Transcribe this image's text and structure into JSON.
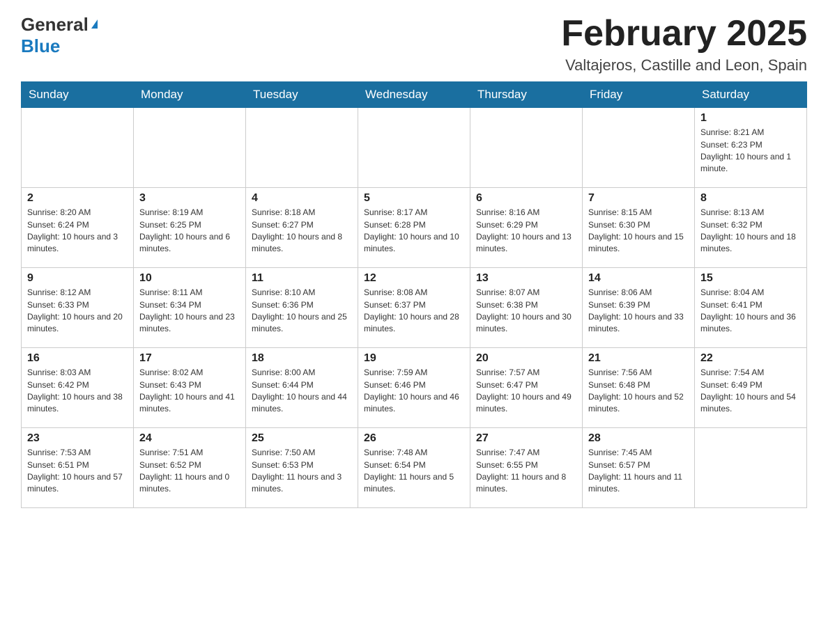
{
  "header": {
    "logo_general": "General",
    "logo_blue": "Blue",
    "title": "February 2025",
    "location": "Valtajeros, Castille and Leon, Spain"
  },
  "days_of_week": [
    "Sunday",
    "Monday",
    "Tuesday",
    "Wednesday",
    "Thursday",
    "Friday",
    "Saturday"
  ],
  "weeks": [
    {
      "days": [
        {
          "number": "",
          "info": ""
        },
        {
          "number": "",
          "info": ""
        },
        {
          "number": "",
          "info": ""
        },
        {
          "number": "",
          "info": ""
        },
        {
          "number": "",
          "info": ""
        },
        {
          "number": "",
          "info": ""
        },
        {
          "number": "1",
          "info": "Sunrise: 8:21 AM\nSunset: 6:23 PM\nDaylight: 10 hours and 1 minute."
        }
      ]
    },
    {
      "days": [
        {
          "number": "2",
          "info": "Sunrise: 8:20 AM\nSunset: 6:24 PM\nDaylight: 10 hours and 3 minutes."
        },
        {
          "number": "3",
          "info": "Sunrise: 8:19 AM\nSunset: 6:25 PM\nDaylight: 10 hours and 6 minutes."
        },
        {
          "number": "4",
          "info": "Sunrise: 8:18 AM\nSunset: 6:27 PM\nDaylight: 10 hours and 8 minutes."
        },
        {
          "number": "5",
          "info": "Sunrise: 8:17 AM\nSunset: 6:28 PM\nDaylight: 10 hours and 10 minutes."
        },
        {
          "number": "6",
          "info": "Sunrise: 8:16 AM\nSunset: 6:29 PM\nDaylight: 10 hours and 13 minutes."
        },
        {
          "number": "7",
          "info": "Sunrise: 8:15 AM\nSunset: 6:30 PM\nDaylight: 10 hours and 15 minutes."
        },
        {
          "number": "8",
          "info": "Sunrise: 8:13 AM\nSunset: 6:32 PM\nDaylight: 10 hours and 18 minutes."
        }
      ]
    },
    {
      "days": [
        {
          "number": "9",
          "info": "Sunrise: 8:12 AM\nSunset: 6:33 PM\nDaylight: 10 hours and 20 minutes."
        },
        {
          "number": "10",
          "info": "Sunrise: 8:11 AM\nSunset: 6:34 PM\nDaylight: 10 hours and 23 minutes."
        },
        {
          "number": "11",
          "info": "Sunrise: 8:10 AM\nSunset: 6:36 PM\nDaylight: 10 hours and 25 minutes."
        },
        {
          "number": "12",
          "info": "Sunrise: 8:08 AM\nSunset: 6:37 PM\nDaylight: 10 hours and 28 minutes."
        },
        {
          "number": "13",
          "info": "Sunrise: 8:07 AM\nSunset: 6:38 PM\nDaylight: 10 hours and 30 minutes."
        },
        {
          "number": "14",
          "info": "Sunrise: 8:06 AM\nSunset: 6:39 PM\nDaylight: 10 hours and 33 minutes."
        },
        {
          "number": "15",
          "info": "Sunrise: 8:04 AM\nSunset: 6:41 PM\nDaylight: 10 hours and 36 minutes."
        }
      ]
    },
    {
      "days": [
        {
          "number": "16",
          "info": "Sunrise: 8:03 AM\nSunset: 6:42 PM\nDaylight: 10 hours and 38 minutes."
        },
        {
          "number": "17",
          "info": "Sunrise: 8:02 AM\nSunset: 6:43 PM\nDaylight: 10 hours and 41 minutes."
        },
        {
          "number": "18",
          "info": "Sunrise: 8:00 AM\nSunset: 6:44 PM\nDaylight: 10 hours and 44 minutes."
        },
        {
          "number": "19",
          "info": "Sunrise: 7:59 AM\nSunset: 6:46 PM\nDaylight: 10 hours and 46 minutes."
        },
        {
          "number": "20",
          "info": "Sunrise: 7:57 AM\nSunset: 6:47 PM\nDaylight: 10 hours and 49 minutes."
        },
        {
          "number": "21",
          "info": "Sunrise: 7:56 AM\nSunset: 6:48 PM\nDaylight: 10 hours and 52 minutes."
        },
        {
          "number": "22",
          "info": "Sunrise: 7:54 AM\nSunset: 6:49 PM\nDaylight: 10 hours and 54 minutes."
        }
      ]
    },
    {
      "days": [
        {
          "number": "23",
          "info": "Sunrise: 7:53 AM\nSunset: 6:51 PM\nDaylight: 10 hours and 57 minutes."
        },
        {
          "number": "24",
          "info": "Sunrise: 7:51 AM\nSunset: 6:52 PM\nDaylight: 11 hours and 0 minutes."
        },
        {
          "number": "25",
          "info": "Sunrise: 7:50 AM\nSunset: 6:53 PM\nDaylight: 11 hours and 3 minutes."
        },
        {
          "number": "26",
          "info": "Sunrise: 7:48 AM\nSunset: 6:54 PM\nDaylight: 11 hours and 5 minutes."
        },
        {
          "number": "27",
          "info": "Sunrise: 7:47 AM\nSunset: 6:55 PM\nDaylight: 11 hours and 8 minutes."
        },
        {
          "number": "28",
          "info": "Sunrise: 7:45 AM\nSunset: 6:57 PM\nDaylight: 11 hours and 11 minutes."
        },
        {
          "number": "",
          "info": ""
        }
      ]
    }
  ]
}
